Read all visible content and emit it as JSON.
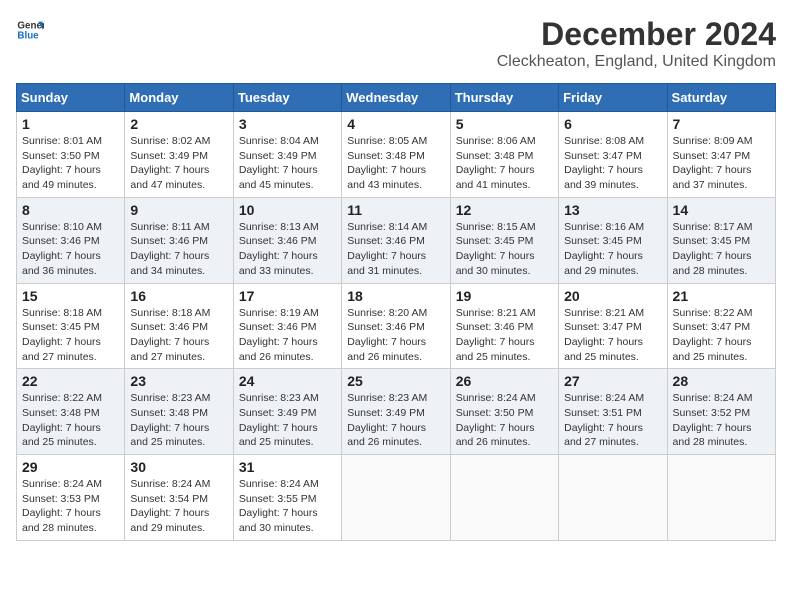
{
  "header": {
    "logo_general": "General",
    "logo_blue": "Blue",
    "month_title": "December 2024",
    "location": "Cleckheaton, England, United Kingdom"
  },
  "days_of_week": [
    "Sunday",
    "Monday",
    "Tuesday",
    "Wednesday",
    "Thursday",
    "Friday",
    "Saturday"
  ],
  "weeks": [
    [
      {
        "day": "1",
        "sunrise": "Sunrise: 8:01 AM",
        "sunset": "Sunset: 3:50 PM",
        "daylight": "Daylight: 7 hours and 49 minutes."
      },
      {
        "day": "2",
        "sunrise": "Sunrise: 8:02 AM",
        "sunset": "Sunset: 3:49 PM",
        "daylight": "Daylight: 7 hours and 47 minutes."
      },
      {
        "day": "3",
        "sunrise": "Sunrise: 8:04 AM",
        "sunset": "Sunset: 3:49 PM",
        "daylight": "Daylight: 7 hours and 45 minutes."
      },
      {
        "day": "4",
        "sunrise": "Sunrise: 8:05 AM",
        "sunset": "Sunset: 3:48 PM",
        "daylight": "Daylight: 7 hours and 43 minutes."
      },
      {
        "day": "5",
        "sunrise": "Sunrise: 8:06 AM",
        "sunset": "Sunset: 3:48 PM",
        "daylight": "Daylight: 7 hours and 41 minutes."
      },
      {
        "day": "6",
        "sunrise": "Sunrise: 8:08 AM",
        "sunset": "Sunset: 3:47 PM",
        "daylight": "Daylight: 7 hours and 39 minutes."
      },
      {
        "day": "7",
        "sunrise": "Sunrise: 8:09 AM",
        "sunset": "Sunset: 3:47 PM",
        "daylight": "Daylight: 7 hours and 37 minutes."
      }
    ],
    [
      {
        "day": "8",
        "sunrise": "Sunrise: 8:10 AM",
        "sunset": "Sunset: 3:46 PM",
        "daylight": "Daylight: 7 hours and 36 minutes."
      },
      {
        "day": "9",
        "sunrise": "Sunrise: 8:11 AM",
        "sunset": "Sunset: 3:46 PM",
        "daylight": "Daylight: 7 hours and 34 minutes."
      },
      {
        "day": "10",
        "sunrise": "Sunrise: 8:13 AM",
        "sunset": "Sunset: 3:46 PM",
        "daylight": "Daylight: 7 hours and 33 minutes."
      },
      {
        "day": "11",
        "sunrise": "Sunrise: 8:14 AM",
        "sunset": "Sunset: 3:46 PM",
        "daylight": "Daylight: 7 hours and 31 minutes."
      },
      {
        "day": "12",
        "sunrise": "Sunrise: 8:15 AM",
        "sunset": "Sunset: 3:45 PM",
        "daylight": "Daylight: 7 hours and 30 minutes."
      },
      {
        "day": "13",
        "sunrise": "Sunrise: 8:16 AM",
        "sunset": "Sunset: 3:45 PM",
        "daylight": "Daylight: 7 hours and 29 minutes."
      },
      {
        "day": "14",
        "sunrise": "Sunrise: 8:17 AM",
        "sunset": "Sunset: 3:45 PM",
        "daylight": "Daylight: 7 hours and 28 minutes."
      }
    ],
    [
      {
        "day": "15",
        "sunrise": "Sunrise: 8:18 AM",
        "sunset": "Sunset: 3:45 PM",
        "daylight": "Daylight: 7 hours and 27 minutes."
      },
      {
        "day": "16",
        "sunrise": "Sunrise: 8:18 AM",
        "sunset": "Sunset: 3:46 PM",
        "daylight": "Daylight: 7 hours and 27 minutes."
      },
      {
        "day": "17",
        "sunrise": "Sunrise: 8:19 AM",
        "sunset": "Sunset: 3:46 PM",
        "daylight": "Daylight: 7 hours and 26 minutes."
      },
      {
        "day": "18",
        "sunrise": "Sunrise: 8:20 AM",
        "sunset": "Sunset: 3:46 PM",
        "daylight": "Daylight: 7 hours and 26 minutes."
      },
      {
        "day": "19",
        "sunrise": "Sunrise: 8:21 AM",
        "sunset": "Sunset: 3:46 PM",
        "daylight": "Daylight: 7 hours and 25 minutes."
      },
      {
        "day": "20",
        "sunrise": "Sunrise: 8:21 AM",
        "sunset": "Sunset: 3:47 PM",
        "daylight": "Daylight: 7 hours and 25 minutes."
      },
      {
        "day": "21",
        "sunrise": "Sunrise: 8:22 AM",
        "sunset": "Sunset: 3:47 PM",
        "daylight": "Daylight: 7 hours and 25 minutes."
      }
    ],
    [
      {
        "day": "22",
        "sunrise": "Sunrise: 8:22 AM",
        "sunset": "Sunset: 3:48 PM",
        "daylight": "Daylight: 7 hours and 25 minutes."
      },
      {
        "day": "23",
        "sunrise": "Sunrise: 8:23 AM",
        "sunset": "Sunset: 3:48 PM",
        "daylight": "Daylight: 7 hours and 25 minutes."
      },
      {
        "day": "24",
        "sunrise": "Sunrise: 8:23 AM",
        "sunset": "Sunset: 3:49 PM",
        "daylight": "Daylight: 7 hours and 25 minutes."
      },
      {
        "day": "25",
        "sunrise": "Sunrise: 8:23 AM",
        "sunset": "Sunset: 3:49 PM",
        "daylight": "Daylight: 7 hours and 26 minutes."
      },
      {
        "day": "26",
        "sunrise": "Sunrise: 8:24 AM",
        "sunset": "Sunset: 3:50 PM",
        "daylight": "Daylight: 7 hours and 26 minutes."
      },
      {
        "day": "27",
        "sunrise": "Sunrise: 8:24 AM",
        "sunset": "Sunset: 3:51 PM",
        "daylight": "Daylight: 7 hours and 27 minutes."
      },
      {
        "day": "28",
        "sunrise": "Sunrise: 8:24 AM",
        "sunset": "Sunset: 3:52 PM",
        "daylight": "Daylight: 7 hours and 28 minutes."
      }
    ],
    [
      {
        "day": "29",
        "sunrise": "Sunrise: 8:24 AM",
        "sunset": "Sunset: 3:53 PM",
        "daylight": "Daylight: 7 hours and 28 minutes."
      },
      {
        "day": "30",
        "sunrise": "Sunrise: 8:24 AM",
        "sunset": "Sunset: 3:54 PM",
        "daylight": "Daylight: 7 hours and 29 minutes."
      },
      {
        "day": "31",
        "sunrise": "Sunrise: 8:24 AM",
        "sunset": "Sunset: 3:55 PM",
        "daylight": "Daylight: 7 hours and 30 minutes."
      },
      null,
      null,
      null,
      null
    ]
  ]
}
